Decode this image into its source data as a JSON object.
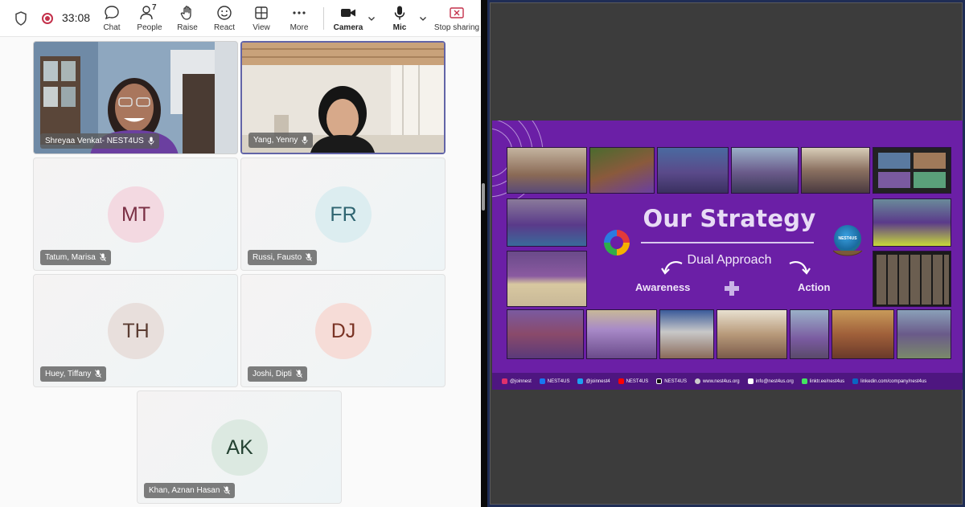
{
  "toolbar": {
    "timer": "33:08",
    "chat_label": "Chat",
    "people_label": "People",
    "people_count": "7",
    "raise_label": "Raise",
    "react_label": "React",
    "view_label": "View",
    "more_label": "More",
    "camera_label": "Camera",
    "mic_label": "Mic",
    "stop_sharing_label": "Stop sharing"
  },
  "participants": [
    {
      "name": "Shreyaa Venkat- NEST4US",
      "type": "video"
    },
    {
      "name": "Yang, Yenny",
      "type": "video"
    },
    {
      "name": "Tatum, Marisa",
      "initials": "MT",
      "avatar_bg": "#f3d9e1",
      "avatar_fg": "#7a2f44"
    },
    {
      "name": "Russi, Fausto",
      "initials": "FR",
      "avatar_bg": "#dcedf0",
      "avatar_fg": "#2e6470"
    },
    {
      "name": "Huey, Tiffany",
      "initials": "TH",
      "avatar_bg": "#e8dfdc",
      "avatar_fg": "#5b3c32"
    },
    {
      "name": "Joshi, Dipti",
      "initials": "DJ",
      "avatar_bg": "#f6dcd7",
      "avatar_fg": "#7a3324"
    },
    {
      "name": "Khan, Aznan Hasan",
      "initials": "AK",
      "avatar_bg": "#dce9e1",
      "avatar_fg": "#244232"
    }
  ],
  "slide": {
    "title": "Our Strategy",
    "subtitle": "Dual Approach",
    "left_label": "Awareness",
    "right_label": "Action",
    "logo_text": "NEST4US",
    "footer": [
      {
        "icon": "instagram-icon",
        "text": "@joinnest",
        "color": "#e1306c"
      },
      {
        "icon": "facebook-icon",
        "text": "NEST4US",
        "color": "#1877f2"
      },
      {
        "icon": "twitter-icon",
        "text": "@joinnest4",
        "color": "#1da1f2"
      },
      {
        "icon": "youtube-icon",
        "text": "NEST4US",
        "color": "#ff0000"
      },
      {
        "icon": "tiktok-icon",
        "text": "NEST4US",
        "color": "#111111"
      },
      {
        "icon": "globe-icon",
        "text": "www.nest4us.org",
        "color": "#cccccc"
      },
      {
        "icon": "mail-icon",
        "text": "info@nest4us.org",
        "color": "#ffffff"
      },
      {
        "icon": "linktree-icon",
        "text": "linktr.ee/nest4us",
        "color": "#43e660"
      },
      {
        "icon": "linkedin-icon",
        "text": "linkedin.com/company/nest4us",
        "color": "#0a66c2"
      }
    ]
  },
  "colors": {
    "slide_bg": "#6b1fa6",
    "teams_accent": "#6264a7",
    "record_red": "#c4314b"
  }
}
